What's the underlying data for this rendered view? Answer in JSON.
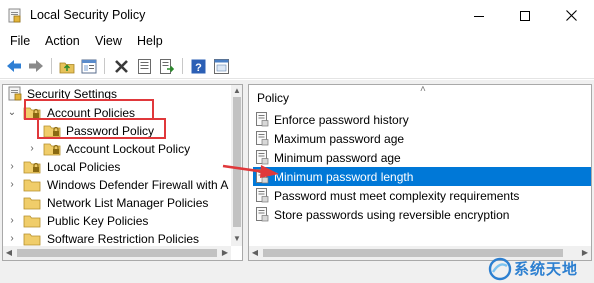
{
  "window": {
    "title": "Local Security Policy",
    "controls": [
      "minimize",
      "maximize",
      "close"
    ]
  },
  "menu": [
    "File",
    "Action",
    "View",
    "Help"
  ],
  "toolbar": {
    "icons": [
      "back-icon",
      "forward-icon",
      "up-folder-icon",
      "show-hide-tree-icon",
      "delete-icon",
      "properties-icon",
      "export-list-icon",
      "help-icon",
      "console-icon"
    ]
  },
  "tree": {
    "items": [
      {
        "label": "Security Settings",
        "level": 0,
        "expanded": true,
        "icon": "security-settings-icon"
      },
      {
        "label": "Account Policies",
        "level": 1,
        "expanded": true,
        "icon": "folder-lock-icon"
      },
      {
        "label": "Password Policy",
        "level": 2,
        "selected": true,
        "icon": "folder-lock-icon"
      },
      {
        "label": "Account Lockout Policy",
        "level": 2,
        "expanded": false,
        "icon": "folder-lock-icon"
      },
      {
        "label": "Local Policies",
        "level": 1,
        "expanded": false,
        "icon": "folder-lock-icon"
      },
      {
        "label": "Windows Defender Firewall with A",
        "level": 1,
        "expanded": false,
        "icon": "folder-icon"
      },
      {
        "label": "Network List Manager Policies",
        "level": 1,
        "expanded": false,
        "icon": "folder-icon"
      },
      {
        "label": "Public Key Policies",
        "level": 1,
        "expanded": false,
        "icon": "folder-icon"
      },
      {
        "label": "Software Restriction Policies",
        "level": 1,
        "expanded": false,
        "icon": "folder-icon"
      }
    ]
  },
  "list": {
    "column_header": "Policy",
    "rows": [
      {
        "label": "Enforce password history"
      },
      {
        "label": "Maximum password age"
      },
      {
        "label": "Minimum password age"
      },
      {
        "label": "Minimum password length",
        "selected": true
      },
      {
        "label": "Password must meet complexity requirements"
      },
      {
        "label": "Store passwords using reversible encryption"
      }
    ]
  },
  "watermark": {
    "text": "系统天地"
  },
  "colors": {
    "selection": "#0078d7",
    "highlight_box": "#e0383b",
    "watermark": "#2c7fd0"
  }
}
